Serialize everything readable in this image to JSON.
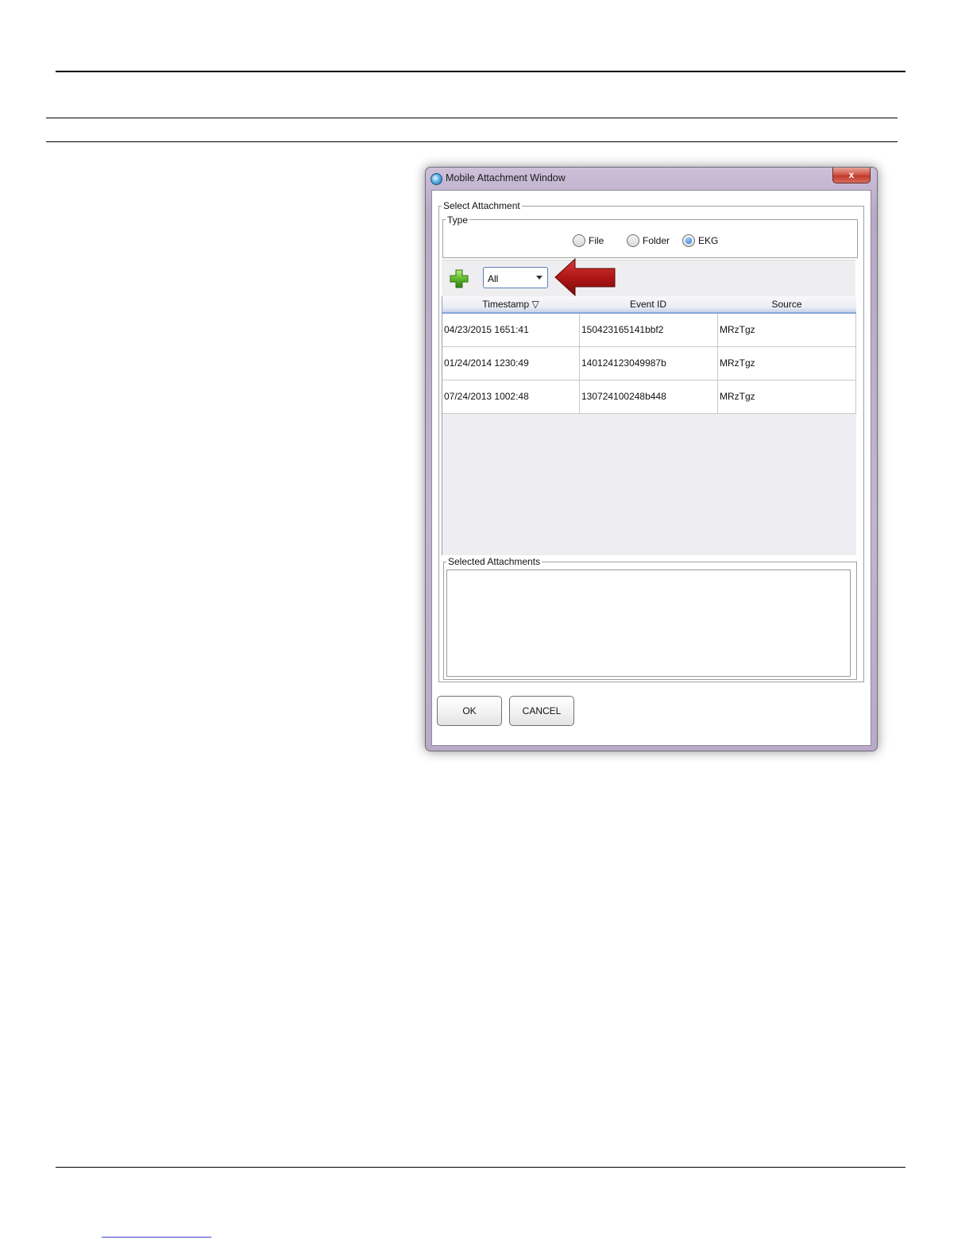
{
  "dialog": {
    "title": "Mobile Attachment Window",
    "close_label": "x"
  },
  "select_attachment": {
    "legend": "Select Attachment",
    "type_group": {
      "legend": "Type",
      "options": [
        {
          "label": "File",
          "checked": false
        },
        {
          "label": "Folder",
          "checked": false
        },
        {
          "label": "EKG",
          "checked": true
        }
      ]
    },
    "filter": {
      "selected": "All"
    },
    "table": {
      "columns": [
        "Timestamp ▽",
        "Event ID",
        "Source"
      ],
      "rows": [
        [
          "04/23/2015 1651:41",
          "150423165141bbf2",
          "MRzTgz"
        ],
        [
          "01/24/2014 1230:49",
          "140124123049987b",
          "MRzTgz"
        ],
        [
          "07/24/2013 1002:48",
          "130724100248b448",
          "MRzTgz"
        ]
      ]
    }
  },
  "selected_attachments": {
    "legend": "Selected Attachments"
  },
  "buttons": {
    "ok": "OK",
    "cancel": "CANCEL"
  },
  "icons": {
    "add": "plus-icon",
    "annotation": "red-arrow-icon"
  },
  "colors": {
    "arrow": "#b01616",
    "plus": "#5fb92b",
    "header_accent": "#86a8d8"
  }
}
